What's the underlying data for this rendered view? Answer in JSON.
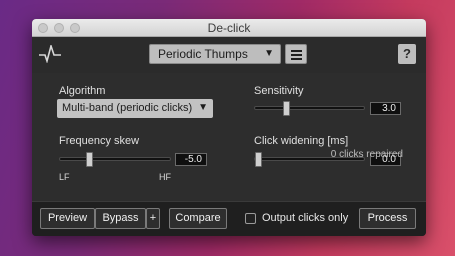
{
  "window": {
    "title": "De-click"
  },
  "header": {
    "preset_value": "Periodic Thumps",
    "preset_arrow": "▼",
    "help_label": "?"
  },
  "controls": {
    "algorithm": {
      "label": "Algorithm",
      "value": "Multi-band (periodic clicks)",
      "arrow": "▼"
    },
    "sensitivity": {
      "label": "Sensitivity",
      "value": "3.0",
      "fraction": 0.3
    },
    "frequency_skew": {
      "label": "Frequency skew",
      "value": "-5.0",
      "fraction": 0.25,
      "min_label": "LF",
      "max_label": "HF"
    },
    "click_widening": {
      "label": "Click widening [ms]",
      "value": "0.0",
      "fraction": 0.0
    }
  },
  "status": {
    "text": "0 clicks repaired"
  },
  "footer": {
    "preview_label": "Preview",
    "bypass_label": "Bypass",
    "plus_label": "+",
    "compare_label": "Compare",
    "output_clicks_label": "Output clicks only",
    "output_clicks_checked": false,
    "process_label": "Process"
  }
}
